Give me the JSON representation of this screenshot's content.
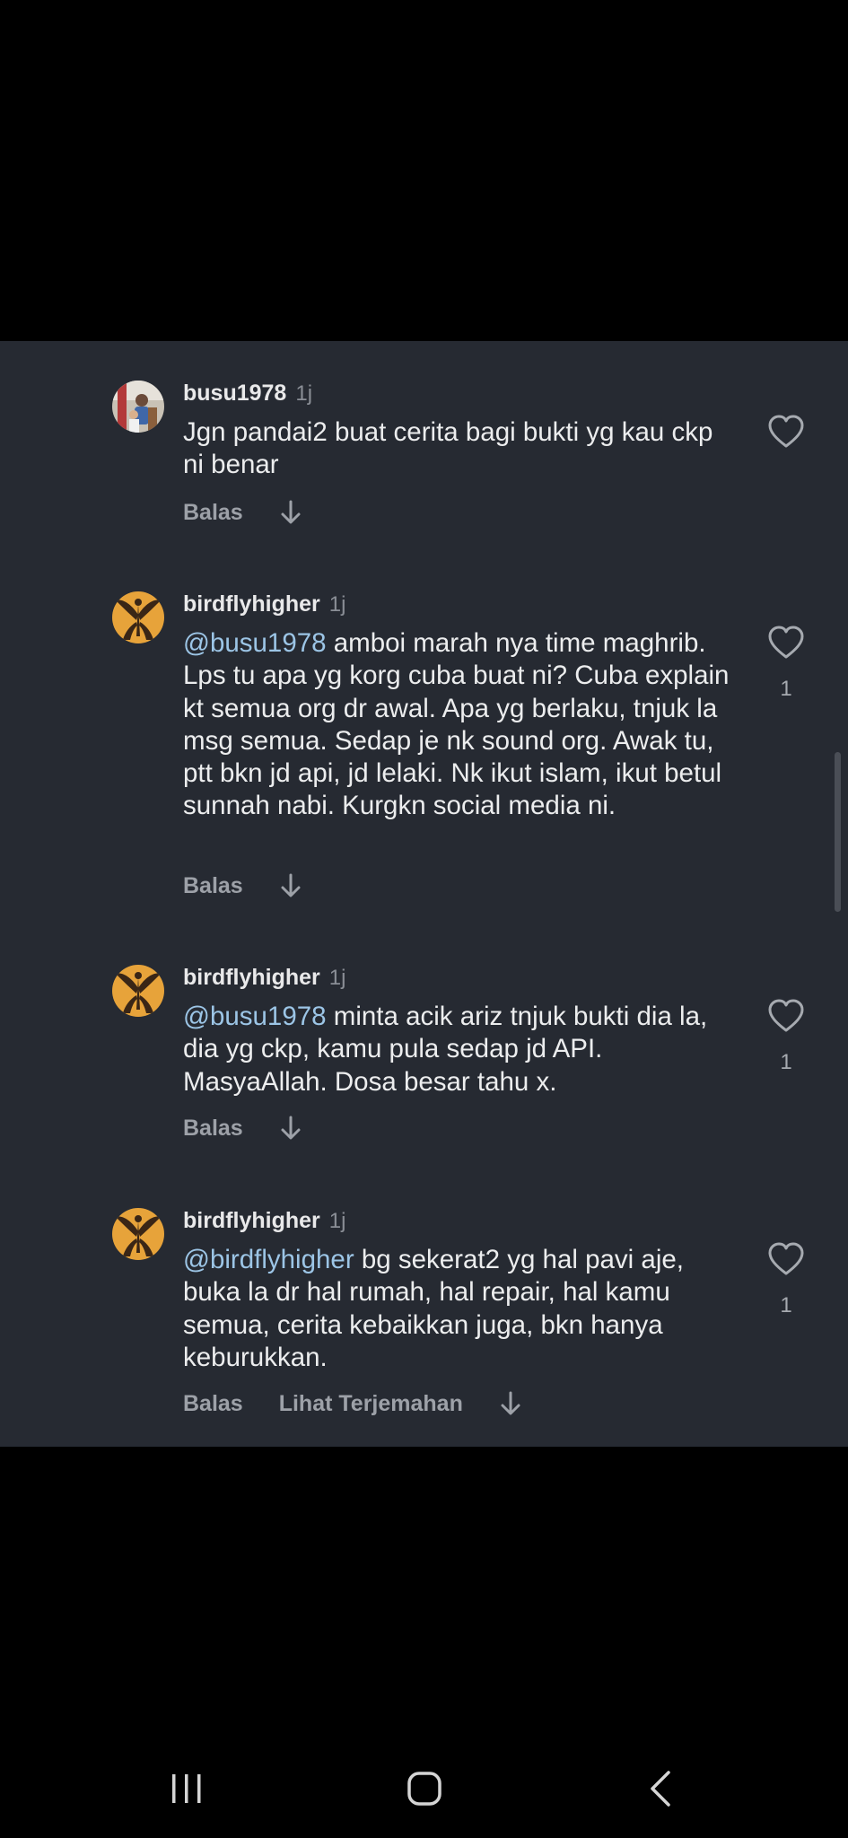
{
  "comments": [
    {
      "username": "busu1978",
      "age": "1j",
      "mention": "",
      "text": "Jgn pandai2 buat cerita bagi bukti yg kau ckp ni benar",
      "reply_label": "Balas",
      "translate_label": "",
      "like_count": "",
      "avatar": "photo-avatar"
    },
    {
      "username": "birdflyhigher",
      "age": "1j",
      "mention": "@busu1978",
      "text": " amboi marah nya time maghrib. Lps tu apa yg korg cuba buat ni? Cuba explain kt semua org dr awal. Apa yg berlaku, tnjuk la msg semua. Sedap je nk sound org. Awak tu, ptt bkn jd api, jd lelaki. Nk ikut islam, ikut betul sunnah nabi. Kurgkn social media ni.",
      "reply_label": "Balas",
      "translate_label": "",
      "like_count": "1",
      "avatar": "bird-avatar"
    },
    {
      "username": "birdflyhigher",
      "age": "1j",
      "mention": "@busu1978",
      "text": " minta acik ariz tnjuk bukti dia la, dia yg ckp, kamu pula sedap jd API. MasyaAllah. Dosa besar tahu x.",
      "reply_label": "Balas",
      "translate_label": "",
      "like_count": "1",
      "avatar": "bird-avatar"
    },
    {
      "username": "birdflyhigher",
      "age": "1j",
      "mention": "@birdflyhigher",
      "text": " bg sekerat2 yg hal pavi aje, buka la dr hal rumah, hal repair, hal kamu semua, cerita kebaikkan juga, bkn hanya keburukkan.",
      "reply_label": "Balas",
      "translate_label": "Lihat Terjemahan",
      "like_count": "1",
      "avatar": "bird-avatar"
    }
  ],
  "icons": {
    "like": "heart-outline-icon",
    "expand": "arrow-down-icon",
    "nav_recent": "recent-apps-icon",
    "nav_home": "home-icon",
    "nav_back": "back-icon"
  },
  "colors": {
    "panel_bg": "#262a32",
    "mention": "#9cc5e6",
    "text": "#ecedee",
    "muted": "#9da1a8",
    "avatar_orange": "#e7a33a"
  }
}
